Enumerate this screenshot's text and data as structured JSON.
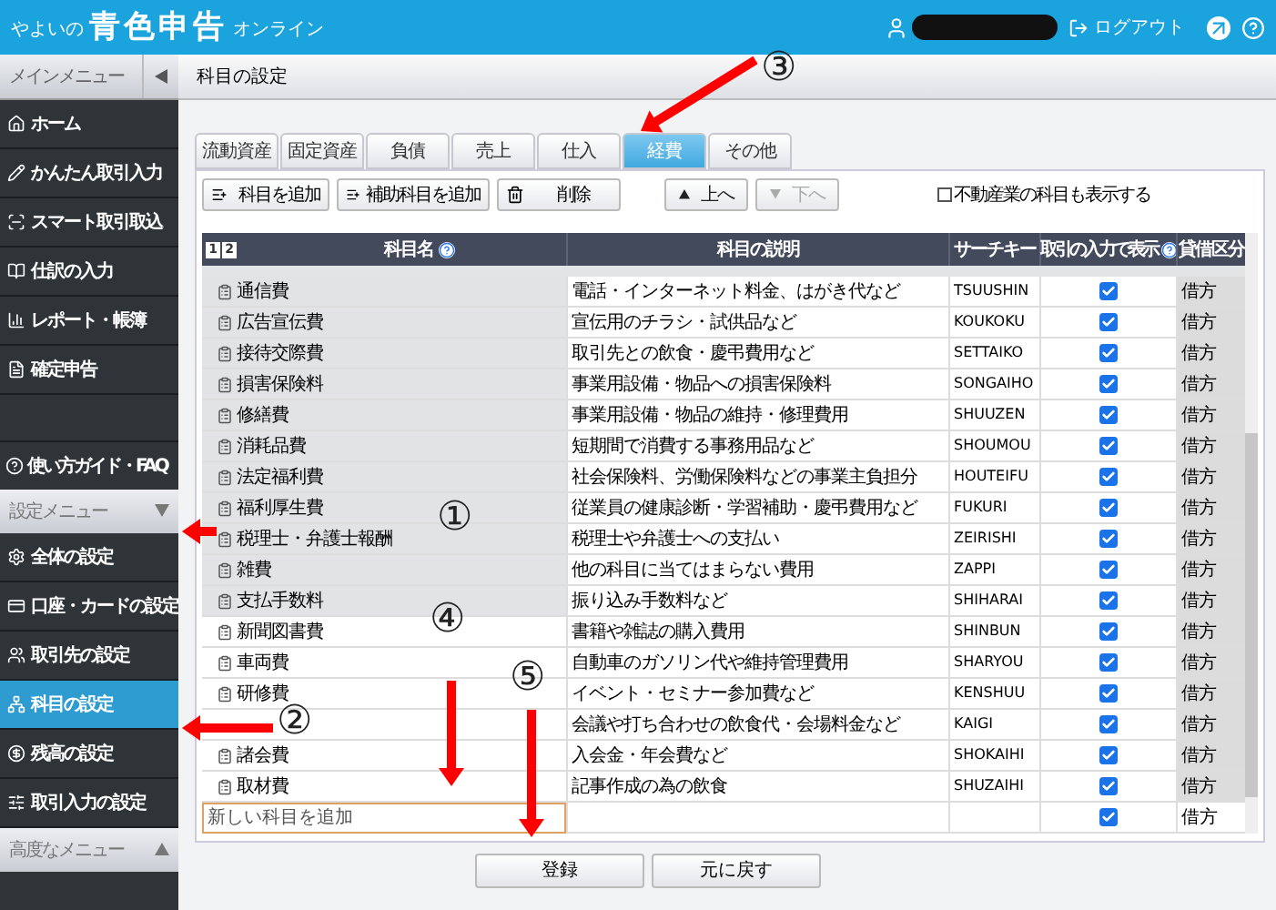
{
  "header": {
    "logo_small": "やよいの",
    "logo_main": "青色申告",
    "logo_suffix": "オンライン",
    "logout": "ログアウト"
  },
  "sidebar": {
    "main_title": "メインメニュー",
    "main_items": [
      {
        "label": "ホーム",
        "selected": false
      },
      {
        "label": "かんたん取引入力",
        "selected": false
      },
      {
        "label": "スマート取引取込",
        "selected": false
      },
      {
        "label": "仕訳の入力",
        "selected": false
      },
      {
        "label": "レポート・帳簿",
        "selected": false
      },
      {
        "label": "確定申告",
        "selected": false
      }
    ],
    "guide": "使い方ガイド・FAQ",
    "settings_title": "設定メニュー",
    "settings_expanded": true,
    "settings_items": [
      {
        "label": "全体の設定",
        "selected": false
      },
      {
        "label": "口座・カードの設定",
        "selected": false
      },
      {
        "label": "取引先の設定",
        "selected": false
      },
      {
        "label": "科目の設定",
        "selected": true
      },
      {
        "label": "残高の設定",
        "selected": false
      },
      {
        "label": "取引入力の設定",
        "selected": false
      }
    ],
    "advanced_title": "高度なメニュー",
    "advanced_expanded": false
  },
  "page_title": "科目の設定",
  "tabs": [
    {
      "label": "流動資産",
      "selected": false
    },
    {
      "label": "固定資産",
      "selected": false
    },
    {
      "label": "負債",
      "selected": false
    },
    {
      "label": "売上",
      "selected": false
    },
    {
      "label": "仕入",
      "selected": false
    },
    {
      "label": "経費",
      "selected": true
    },
    {
      "label": "その他",
      "selected": false
    }
  ],
  "toolbar": {
    "add": "科目を追加",
    "add_sub": "補助科目を追加",
    "delete": "削除",
    "up": "上へ",
    "up_disabled": false,
    "down": "下へ",
    "down_disabled": true,
    "realestate_label": "不動産業の科目も表示する",
    "realestate_checked": false
  },
  "table": {
    "pages": [
      "1",
      "2"
    ],
    "columns": [
      "科目名",
      "科目の説明",
      "サーチキー",
      "取引の入力で表示",
      "貸借区分"
    ],
    "rows": [
      {
        "name": "通信費",
        "description": "電話・インターネット料金、はがき代など",
        "search_key": "TSUUSHIN",
        "shown": true,
        "side": "借方",
        "kind": "preset"
      },
      {
        "name": "広告宣伝費",
        "description": "宣伝用のチラシ・試供品など",
        "search_key": "KOUKOKU",
        "shown": true,
        "side": "借方",
        "kind": "preset"
      },
      {
        "name": "接待交際費",
        "description": "取引先との飲食・慶弔費用など",
        "search_key": "SETTAIKO",
        "shown": true,
        "side": "借方",
        "kind": "preset"
      },
      {
        "name": "損害保険料",
        "description": "事業用設備・物品への損害保険料",
        "search_key": "SONGAIHO",
        "shown": true,
        "side": "借方",
        "kind": "preset"
      },
      {
        "name": "修繕費",
        "description": "事業用設備・物品の維持・修理費用",
        "search_key": "SHUUZEN",
        "shown": true,
        "side": "借方",
        "kind": "preset"
      },
      {
        "name": "消耗品費",
        "description": "短期間で消費する事務用品など",
        "search_key": "SHOUMOU",
        "shown": true,
        "side": "借方",
        "kind": "preset"
      },
      {
        "name": "法定福利費",
        "description": "社会保険料、労働保険料などの事業主負担分",
        "search_key": "HOUTEIFU",
        "shown": true,
        "side": "借方",
        "kind": "preset"
      },
      {
        "name": "福利厚生費",
        "description": "従業員の健康診断・学習補助・慶弔費用など",
        "search_key": "FUKURI",
        "shown": true,
        "side": "借方",
        "kind": "preset"
      },
      {
        "name": "税理士・弁護士報酬",
        "description": "税理士や弁護士への支払い",
        "search_key": "ZEIRISHI",
        "shown": true,
        "side": "借方",
        "kind": "preset"
      },
      {
        "name": "雑費",
        "description": "他の科目に当てはまらない費用",
        "search_key": "ZAPPI",
        "shown": true,
        "side": "借方",
        "kind": "preset"
      },
      {
        "name": "支払手数料",
        "description": "振り込み手数料など",
        "search_key": "SHIHARAI",
        "shown": true,
        "side": "借方",
        "kind": "preset"
      },
      {
        "name": "新聞図書費",
        "description": "書籍や雑誌の購入費用",
        "search_key": "SHINBUN",
        "shown": true,
        "side": "借方",
        "kind": "custom"
      },
      {
        "name": "車両費",
        "description": "自動車のガソリン代や維持管理費用",
        "search_key": "SHARYOU",
        "shown": true,
        "side": "借方",
        "kind": "custom"
      },
      {
        "name": "研修費",
        "description": "イベント・セミナー参加費など",
        "search_key": "KENSHUU",
        "shown": true,
        "side": "借方",
        "kind": "custom"
      },
      {
        "description": "会議や打ち合わせの飲食代・会場料金など",
        "search_key": "KAIGI",
        "shown": true,
        "side": "借方",
        "kind": "custom"
      },
      {
        "name": "諸会費",
        "description": "入会金・年会費など",
        "search_key": "SHOKAIHI",
        "shown": true,
        "side": "借方",
        "kind": "custom"
      },
      {
        "name": "取材費",
        "description": "記事作成の為の飲食",
        "search_key": "SHUZAIHI",
        "shown": true,
        "side": "借方",
        "kind": "custom"
      }
    ],
    "new_row": {
      "placeholder": "新しい科目を追加",
      "shown": true,
      "side": "借方"
    }
  },
  "buttons": [
    "登録",
    "元に戻す"
  ],
  "annotations": [
    {
      "number": "③"
    },
    {
      "number": "①"
    },
    {
      "number": "②"
    },
    {
      "number": "④"
    },
    {
      "number": "⑤"
    }
  ]
}
